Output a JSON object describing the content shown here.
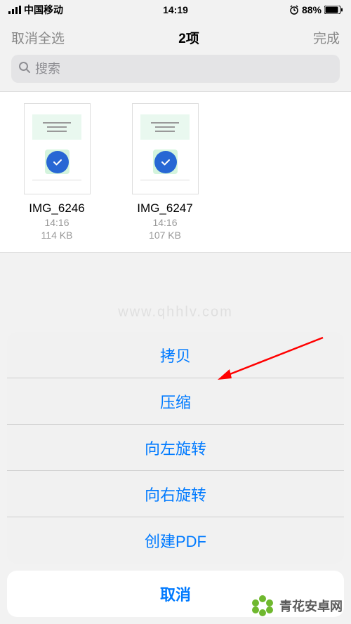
{
  "status_bar": {
    "carrier": "中国移动",
    "time": "14:19",
    "battery_percent": "88%"
  },
  "nav": {
    "left_label": "取消全选",
    "title": "2项",
    "right_label": "完成"
  },
  "search": {
    "placeholder": "搜索"
  },
  "files": [
    {
      "name": "IMG_6246",
      "time": "14:16",
      "size": "114 KB"
    },
    {
      "name": "IMG_6247",
      "time": "14:16",
      "size": "107 KB"
    }
  ],
  "actions": {
    "items": [
      {
        "label": "拷贝"
      },
      {
        "label": "压缩"
      },
      {
        "label": "向左旋转"
      },
      {
        "label": "向右旋转"
      },
      {
        "label": "创建PDF"
      }
    ],
    "cancel_label": "取消"
  },
  "watermark": {
    "center_text": "www.qhhlv.com",
    "logo_text": "青花安卓网"
  }
}
